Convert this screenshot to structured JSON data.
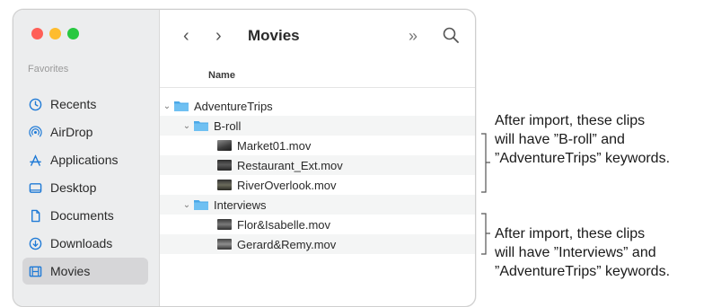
{
  "window": {
    "sidebar": {
      "section_label": "Favorites",
      "items": [
        {
          "label": "Recents",
          "icon": "clock-icon",
          "selected": false
        },
        {
          "label": "AirDrop",
          "icon": "airdrop-icon",
          "selected": false
        },
        {
          "label": "Applications",
          "icon": "applications-icon",
          "selected": false
        },
        {
          "label": "Desktop",
          "icon": "desktop-icon",
          "selected": false
        },
        {
          "label": "Documents",
          "icon": "document-icon",
          "selected": false
        },
        {
          "label": "Downloads",
          "icon": "download-icon",
          "selected": false
        },
        {
          "label": "Movies",
          "icon": "film-icon",
          "selected": true
        }
      ]
    },
    "toolbar": {
      "back_glyph": "‹",
      "forward_glyph": "›",
      "title": "Movies",
      "more_glyph": "»"
    },
    "list": {
      "column_name": "Name",
      "rows": [
        {
          "name": "AdventureTrips",
          "type": "folder",
          "expanded": true,
          "level": 0
        },
        {
          "name": "B-roll",
          "type": "folder",
          "expanded": true,
          "level": 1
        },
        {
          "name": "Market01.mov",
          "type": "movie",
          "level": 2
        },
        {
          "name": "Restaurant_Ext.mov",
          "type": "movie",
          "level": 2
        },
        {
          "name": "RiverOverlook.mov",
          "type": "movie",
          "level": 2
        },
        {
          "name": "Interviews",
          "type": "folder",
          "expanded": true,
          "level": 1
        },
        {
          "name": "Flor&Isabelle.mov",
          "type": "movie",
          "level": 2
        },
        {
          "name": "Gerard&Remy.mov",
          "type": "movie",
          "level": 2
        }
      ]
    }
  },
  "annotations": [
    {
      "lines": [
        "After import, these clips",
        "will have ”B-roll” and",
        "”AdventureTrips” keywords."
      ]
    },
    {
      "lines": [
        "After import, these clips",
        "will have ”Interviews” and",
        "”AdventureTrips” keywords."
      ]
    }
  ],
  "colors": {
    "folder": "#4aa8e8",
    "sidebar_bg": "#ecedee",
    "selected_bg": "#d6d6d8",
    "icon_blue": "#1f7ad6"
  }
}
